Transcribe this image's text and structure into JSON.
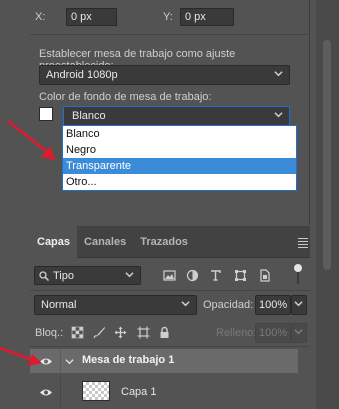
{
  "transform": {
    "x_label": "X:",
    "x_value": "0 px",
    "y_label": "Y:",
    "y_value": "0 px"
  },
  "preset": {
    "label": "Establecer mesa de trabajo como ajuste preestablecido:",
    "value": "Android 1080p"
  },
  "background": {
    "label": "Color de fondo de mesa de trabajo:",
    "value": "Blanco",
    "swatch_color": "#ffffff",
    "options": [
      "Blanco",
      "Negro",
      "Transparente",
      "Otro..."
    ],
    "selected_option": "Transparente"
  },
  "layers_panel": {
    "tabs": [
      "Capas",
      "Canales",
      "Trazados"
    ],
    "active_tab": "Capas",
    "filter_value": "Tipo",
    "blend_mode": "Normal",
    "opacity_label": "Opacidad:",
    "opacity_value": "100%",
    "lock_label": "Bloq.:",
    "fill_label": "Relleno:",
    "fill_value": "100%",
    "group_name": "Mesa de trabajo 1",
    "layer_name": "Capa 1"
  },
  "colors": {
    "annotation_arrow": "#e0192f",
    "selection": "#3c8bd9"
  }
}
